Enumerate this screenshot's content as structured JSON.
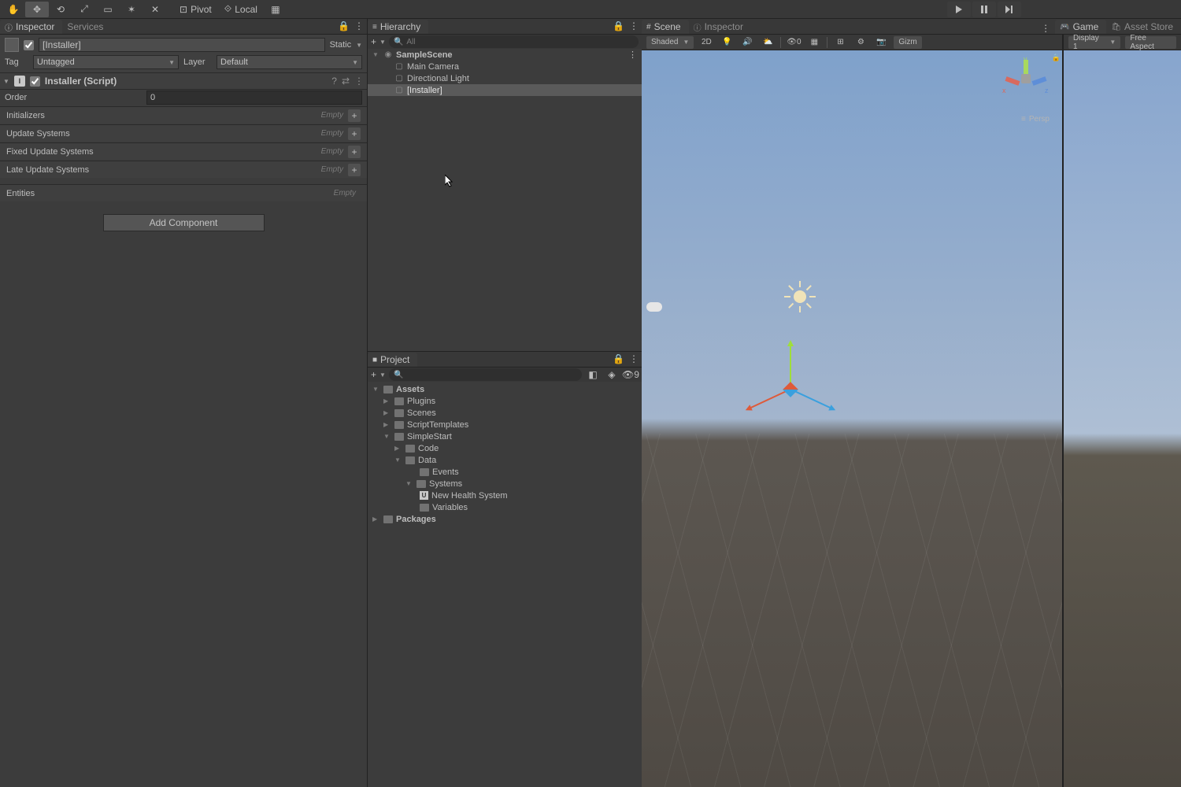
{
  "toolbar": {
    "pivot": "Pivot",
    "local": "Local"
  },
  "inspector": {
    "tab_label": "Inspector",
    "tab_services": "Services",
    "object_name": "[Installer]",
    "static_label": "Static",
    "tag_label": "Tag",
    "tag_value": "Untagged",
    "layer_label": "Layer",
    "layer_value": "Default",
    "component_title": "Installer (Script)",
    "order_label": "Order",
    "order_value": "0",
    "lists": {
      "initializers": "Initializers",
      "update": "Update Systems",
      "fixed": "Fixed Update Systems",
      "late": "Late Update Systems",
      "entities": "Entities"
    },
    "empty_label": "Empty",
    "add_component": "Add Component"
  },
  "hierarchy": {
    "tab_label": "Hierarchy",
    "search_ph": "All",
    "scene": "SampleScene",
    "items": [
      "Main Camera",
      "Directional Light",
      "[Installer]"
    ]
  },
  "project": {
    "tab_label": "Project",
    "hidden_count": "9",
    "tree": {
      "assets": "Assets",
      "plugins": "Plugins",
      "scenes": "Scenes",
      "script_templates": "ScriptTemplates",
      "simple_start": "SimpleStart",
      "code": "Code",
      "data": "Data",
      "events": "Events",
      "systems": "Systems",
      "new_health": "New Health System",
      "variables": "Variables",
      "packages": "Packages"
    }
  },
  "scene": {
    "tab_label": "Scene",
    "inspector_tab": "Inspector",
    "game_tab": "Game",
    "asset_store_tab": "Asset Store",
    "shaded": "Shaded",
    "twod": "2D",
    "hidden0": "0",
    "gizmos": "Gizm",
    "display": "Display 1",
    "aspect": "Free Aspect",
    "persp": "Persp",
    "axis_x": "x",
    "axis_y": "y",
    "axis_z": "z"
  }
}
